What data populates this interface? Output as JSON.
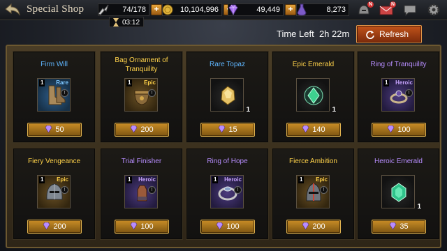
{
  "header": {
    "title": "Special Shop",
    "stamina": "74/178",
    "stamina_timer": "03:12",
    "gold": "10,104,996",
    "gems": "49,449",
    "points": "8,273",
    "badge_label": "N"
  },
  "shop": {
    "time_left_label": "Time Left",
    "time_left": "2h 22m",
    "refresh_label": "Refresh"
  },
  "items": [
    {
      "name": "Firm Will",
      "level": "1",
      "grade": "Rare",
      "qty": "",
      "price": "50",
      "tier": "rare"
    },
    {
      "name": "Bag Ornament of Tranquility",
      "level": "1",
      "grade": "Epic",
      "qty": "",
      "price": "200",
      "tier": "epic"
    },
    {
      "name": "Rare Topaz",
      "level": "",
      "grade": "",
      "qty": "1",
      "price": "15",
      "tier": "rare"
    },
    {
      "name": "Epic Emerald",
      "level": "",
      "grade": "",
      "qty": "1",
      "price": "140",
      "tier": "epic"
    },
    {
      "name": "Ring of Tranquility",
      "level": "1",
      "grade": "Heroic",
      "qty": "",
      "price": "100",
      "tier": "heroic"
    },
    {
      "name": "Fiery Vengeance",
      "level": "1",
      "grade": "Epic",
      "qty": "",
      "price": "200",
      "tier": "epic"
    },
    {
      "name": "Trial Finisher",
      "level": "1",
      "grade": "Heroic",
      "qty": "",
      "price": "100",
      "tier": "heroic"
    },
    {
      "name": "Ring of Hope",
      "level": "1",
      "grade": "Heroic",
      "qty": "",
      "price": "100",
      "tier": "heroic"
    },
    {
      "name": "Fierce Ambition",
      "level": "1",
      "grade": "Epic",
      "qty": "",
      "price": "200",
      "tier": "epic"
    },
    {
      "name": "Heroic Emerald",
      "level": "",
      "grade": "",
      "qty": "1",
      "price": "35",
      "tier": "heroic"
    }
  ],
  "colors": {
    "rare": "#5fb6ff",
    "epic": "#ffd24a",
    "heroic": "#b78dff",
    "price_button": "#c98d26",
    "refresh_button": "#c2541b"
  }
}
